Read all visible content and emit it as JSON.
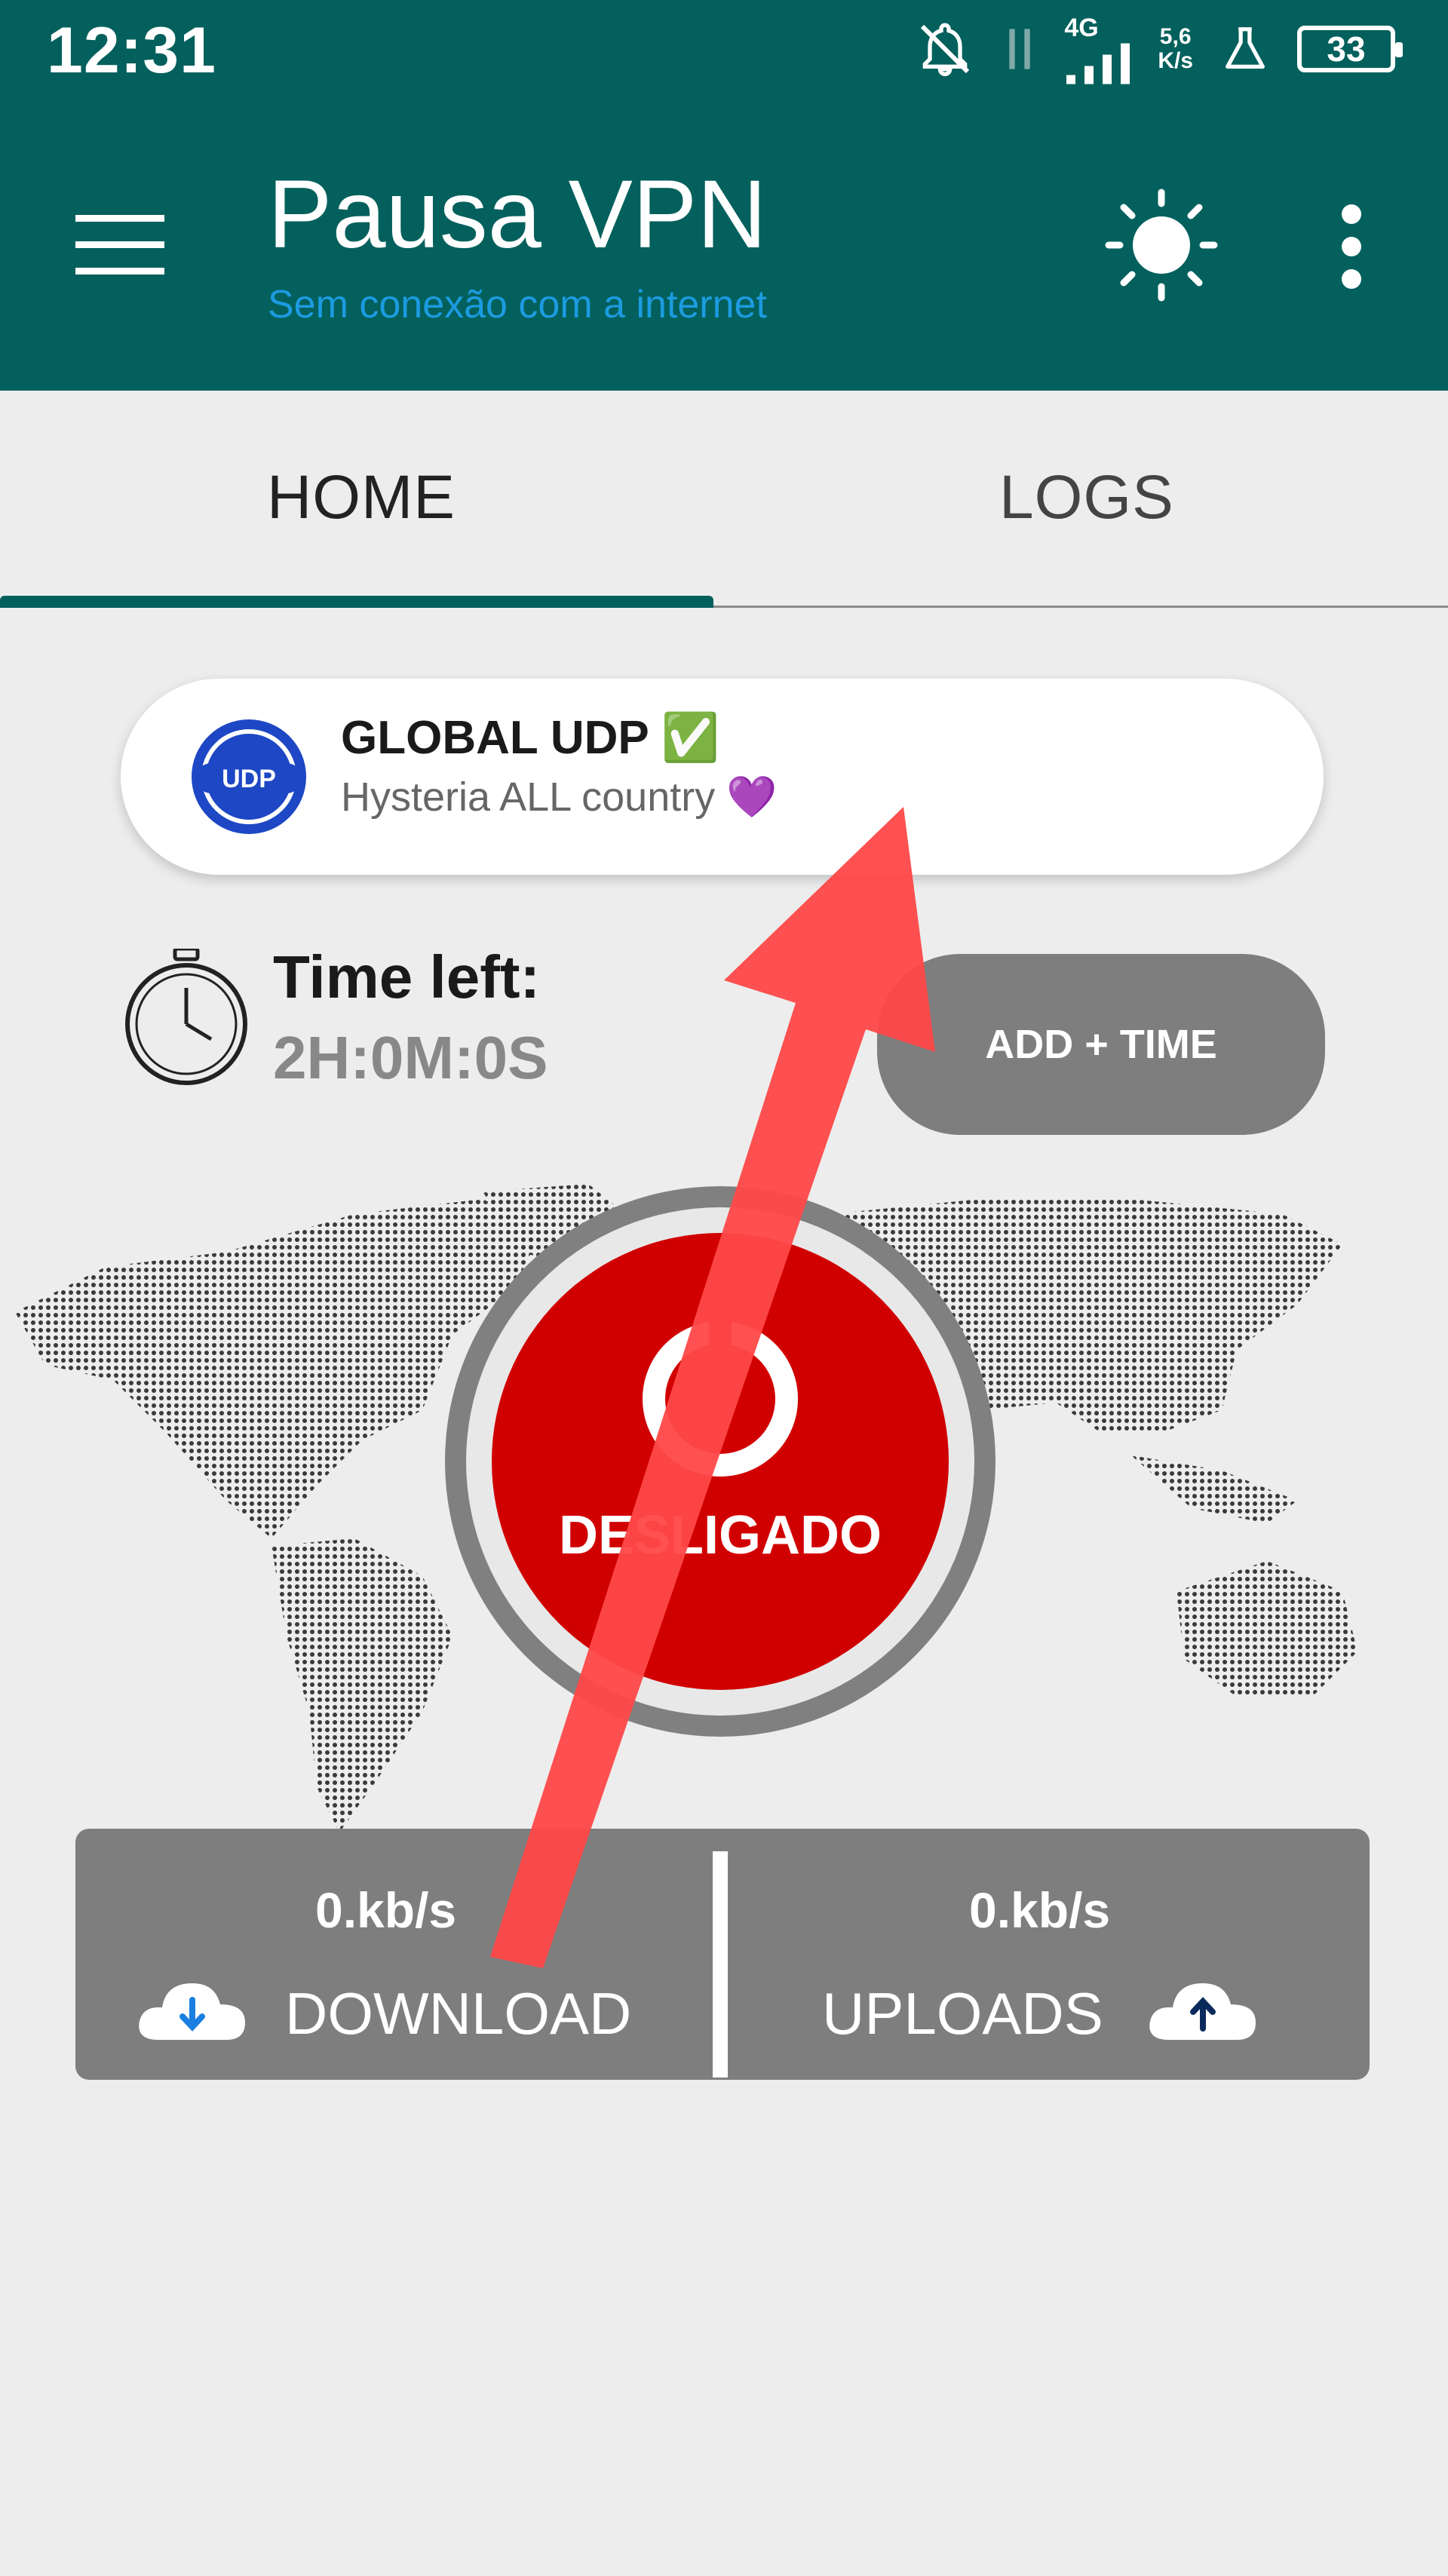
{
  "status_bar": {
    "time": "12:31",
    "network_type": "4G",
    "net_speed_value": "5,6",
    "net_speed_unit": "K/s",
    "battery": "33"
  },
  "app_bar": {
    "title": "Pausa VPN",
    "subtitle": "Sem conexão com a internet",
    "menu_icon": "hamburger-icon",
    "theme_icon": "sun-icon",
    "more_icon": "more-vert-icon"
  },
  "tabs": [
    {
      "label": "HOME",
      "active": true
    },
    {
      "label": "LOGS",
      "active": false
    }
  ],
  "server": {
    "name": "GLOBAL UDP ✅",
    "description": "Hysteria ALL country 💜",
    "logo_text": "UDP"
  },
  "timer": {
    "label": "Time left:",
    "value": "2H:0M:0S",
    "add_button": "ADD + TIME"
  },
  "power": {
    "status": "DESLIGADO"
  },
  "stats": {
    "download_value": "0.kb/s",
    "download_label": "DOWNLOAD",
    "upload_value": "0.kb/s",
    "upload_label": "UPLOADS"
  },
  "colors": {
    "primary": "#03605c",
    "subtitle": "#1c9be0",
    "power_off": "#d10000",
    "panel": "#7e7e7e",
    "arrow": "#ff4848"
  }
}
